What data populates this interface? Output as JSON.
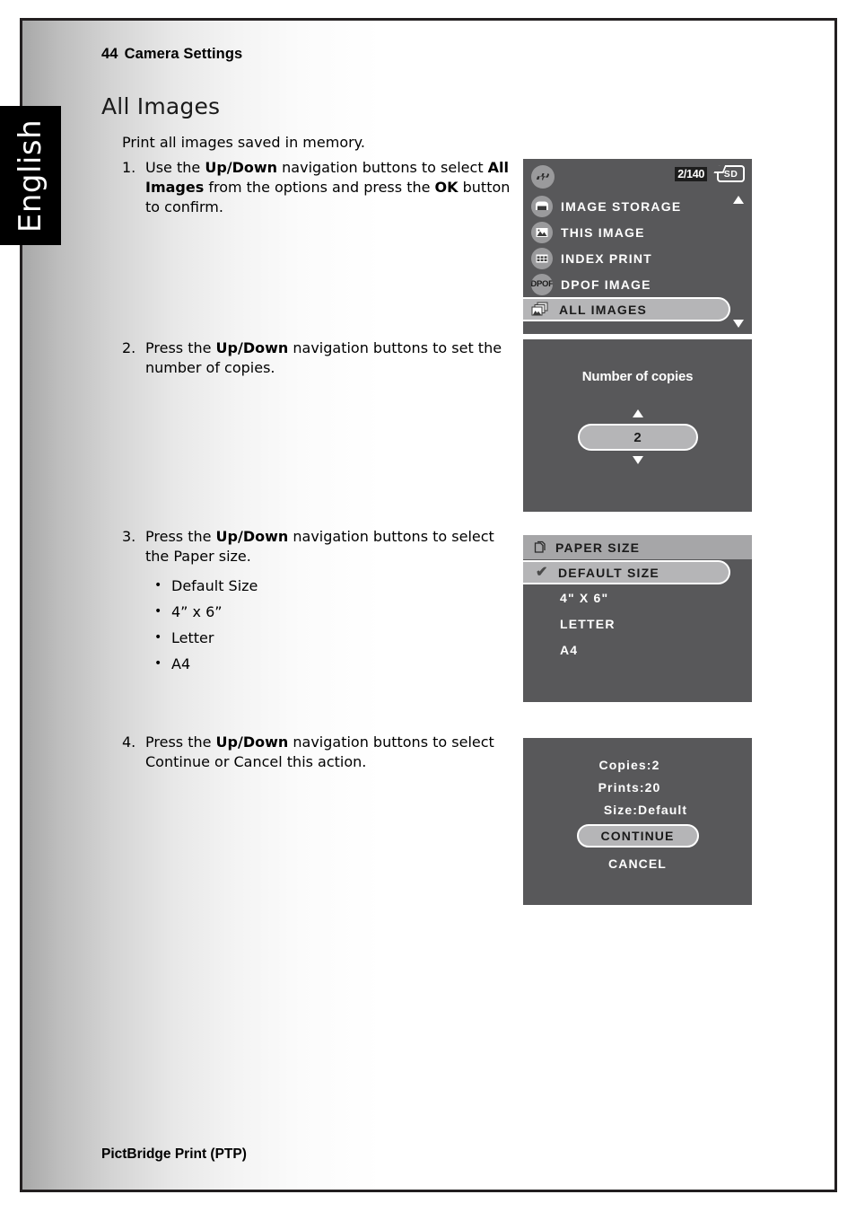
{
  "language_tab": {
    "label": "English"
  },
  "header": {
    "page_number": "44",
    "title": "Camera Settings"
  },
  "section": {
    "title": "All Images",
    "intro": "Print all images saved in memory."
  },
  "steps": [
    {
      "marker": "1.",
      "parts": [
        {
          "t": "Use the ",
          "b": false
        },
        {
          "t": "Up/Down",
          "b": true
        },
        {
          "t": " navigation buttons to select ",
          "b": false
        },
        {
          "t": "All Images",
          "b": true
        },
        {
          "t": " from the options and press the ",
          "b": false
        },
        {
          "t": "OK",
          "b": true
        },
        {
          "t": " button to confirm.",
          "b": false
        }
      ]
    },
    {
      "marker": "2.",
      "parts": [
        {
          "t": "Press the ",
          "b": false
        },
        {
          "t": "Up/Down",
          "b": true
        },
        {
          "t": " navigation buttons to set the number of copies.",
          "b": false
        }
      ]
    },
    {
      "marker": "3.",
      "parts": [
        {
          "t": "Press the ",
          "b": false
        },
        {
          "t": "Up/Down",
          "b": true
        },
        {
          "t": " navigation buttons to select the Paper size.",
          "b": false
        }
      ]
    },
    {
      "marker": "4.",
      "parts": [
        {
          "t": "Press the ",
          "b": false
        },
        {
          "t": "Up/Down",
          "b": true
        },
        {
          "t": " navigation buttons to select Continue or Cancel this action.",
          "b": false
        }
      ]
    }
  ],
  "paper_size_bullets": [
    "Default Size",
    "4” x 6”",
    "Letter",
    "A4"
  ],
  "footer": {
    "label": "PictBridge Print (PTP)"
  },
  "screens": {
    "print_menu": {
      "counter": "2/140",
      "card_badge": "SD",
      "mode_icon": "camera-mode-icon",
      "items": [
        {
          "label": "IMAGE STORAGE",
          "icon": "folder-icon",
          "selected": false
        },
        {
          "label": "THIS IMAGE",
          "icon": "photo-icon",
          "selected": false
        },
        {
          "label": "INDEX PRINT",
          "icon": "grid-icon",
          "selected": false
        },
        {
          "label": "DPOF IMAGE",
          "icon": "dpof-icon",
          "icon_text": "DPOF",
          "selected": false
        },
        {
          "label": "ALL IMAGES",
          "icon": "stacked-photos-icon",
          "selected": true
        }
      ],
      "scroll_up_icon": "triangle-up-icon",
      "scroll_down_icon": "triangle-down-icon"
    },
    "copies": {
      "title": "Number of copies",
      "value": "2",
      "up_icon": "triangle-up-icon",
      "down_icon": "triangle-down-icon"
    },
    "paper_size": {
      "header": "PAPER SIZE",
      "header_icon": "pages-icon",
      "check_glyph": "✔",
      "items": [
        {
          "label": "DEFAULT SIZE",
          "selected": true
        },
        {
          "label": "4\" X 6\"",
          "selected": false
        },
        {
          "label": "LETTER",
          "selected": false
        },
        {
          "label": "A4",
          "selected": false
        }
      ]
    },
    "summary": {
      "copies": "Copies:2",
      "prints": "Prints:20",
      "size": "Size:Default",
      "continue_label": "CONTINUE",
      "cancel_label": "CANCEL"
    }
  },
  "colors": {
    "lcd_background": "#58585a",
    "lcd_highlight": "#b5b5b7",
    "lcd_header": "#a6a6a8",
    "page_border": "#231f20",
    "tab_background": "#000000"
  }
}
